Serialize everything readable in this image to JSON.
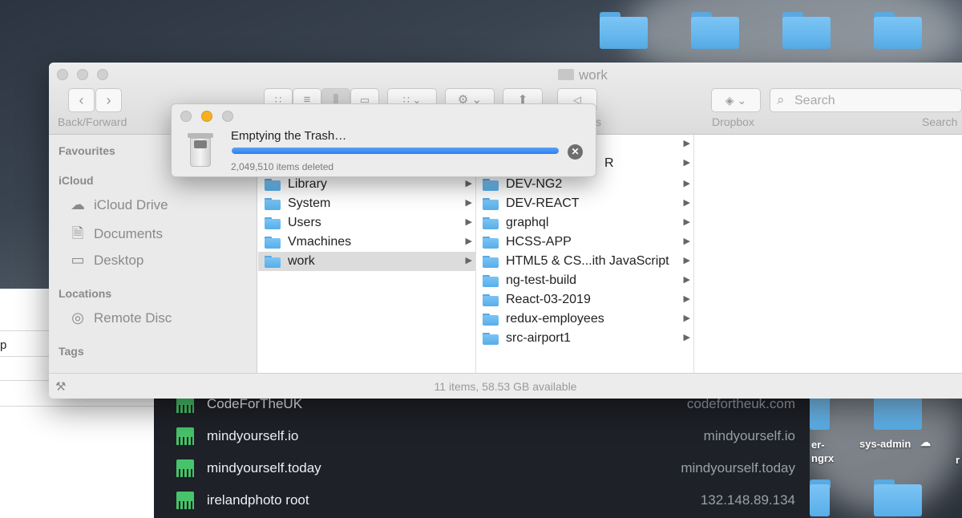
{
  "desktop": {
    "folder_labels": [
      "er-\nngrx",
      "sys-admin"
    ]
  },
  "finder": {
    "title": "work",
    "toolbar_labels": {
      "back_forward": "Back/Forward",
      "tags": "s",
      "dropbox": "Dropbox",
      "search": "Search"
    },
    "search_placeholder": "Search",
    "sidebar": {
      "favourites": "Favourites",
      "icloud": "iCloud",
      "icloud_items": [
        "iCloud Drive",
        "Documents",
        "Desktop"
      ],
      "locations": "Locations",
      "location_items": [
        "Remote Disc"
      ],
      "tags": "Tags"
    },
    "column1": [
      "Library",
      "System",
      "Users",
      "Vmachines",
      "work"
    ],
    "column1_selected": "work",
    "column2_partial": "R",
    "column2": [
      "DEV-NG2",
      "DEV-REACT",
      "graphql",
      "HCSS-APP",
      "HTML5 & CS...ith JavaScript",
      "ng-test-build",
      "React-03-2019",
      "redux-employees",
      "src-airport1"
    ],
    "status": "11 items, 58.53 GB available"
  },
  "dialog": {
    "title": "Emptying the Trash…",
    "status": "2,049,510 items deleted",
    "progress": 1.0
  },
  "background_window": {
    "partial_text": "p"
  },
  "servers": [
    {
      "name": "CodeForTheUK",
      "host": "codefortheuk.com"
    },
    {
      "name": "mindyourself.io",
      "host": "mindyourself.io"
    },
    {
      "name": "mindyourself.today",
      "host": "mindyourself.today"
    },
    {
      "name": "irelandphoto root",
      "host": "132.148.89.134"
    }
  ]
}
